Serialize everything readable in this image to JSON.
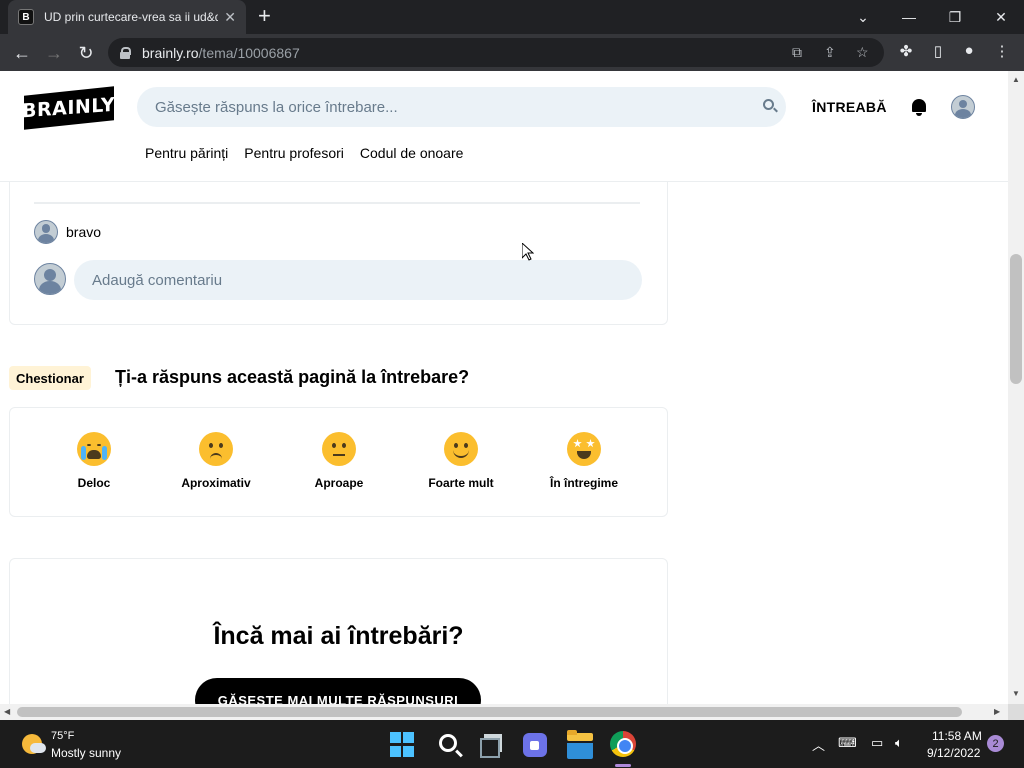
{
  "browser": {
    "tab_title": "UD prin curtecare-vrea sa ii ud&q",
    "tab_favicon": "B",
    "tab_close": "✕",
    "new_tab": "+",
    "url_host": "brainly.ro",
    "url_path": "/tema/10006867",
    "controls": {
      "dropdown": "⌄",
      "minimize": "—",
      "restore": "❐",
      "close": "✕"
    }
  },
  "site": {
    "logo": "BRAINLY",
    "search_placeholder": "Găsește răspuns la orice întrebare...",
    "ask_label": "ÎNTREABĂ",
    "subnav": [
      "Pentru părinți",
      "Pentru profesori",
      "Codul de onoare"
    ]
  },
  "comments": {
    "items": [
      {
        "text": "bravo"
      }
    ],
    "add_placeholder": "Adaugă comentariu"
  },
  "quiz": {
    "tag": "Chestionar",
    "question": "Ți-a răspuns această pagină la întrebare?",
    "options": [
      {
        "label": "Deloc",
        "icon": "crying-face-icon"
      },
      {
        "label": "Aproximativ",
        "icon": "sad-face-icon"
      },
      {
        "label": "Aproape",
        "icon": "neutral-face-icon"
      },
      {
        "label": "Foarte mult",
        "icon": "smiling-face-icon"
      },
      {
        "label": "În întregime",
        "icon": "star-eyes-face-icon"
      }
    ]
  },
  "more": {
    "title": "Încă mai ai întrebări?",
    "button": "GĂSEȘTE MAI MULTE RĂSPUNSURI"
  },
  "taskbar": {
    "weather_temp": "75°F",
    "weather_desc": "Mostly sunny",
    "time": "11:58 AM",
    "date": "9/12/2022",
    "notification_count": "2"
  },
  "colors": {
    "brand": "#000000",
    "search_bg": "#ebf2f7",
    "tag_bg": "#fff3d6",
    "emoji": "#fbbe2e"
  }
}
